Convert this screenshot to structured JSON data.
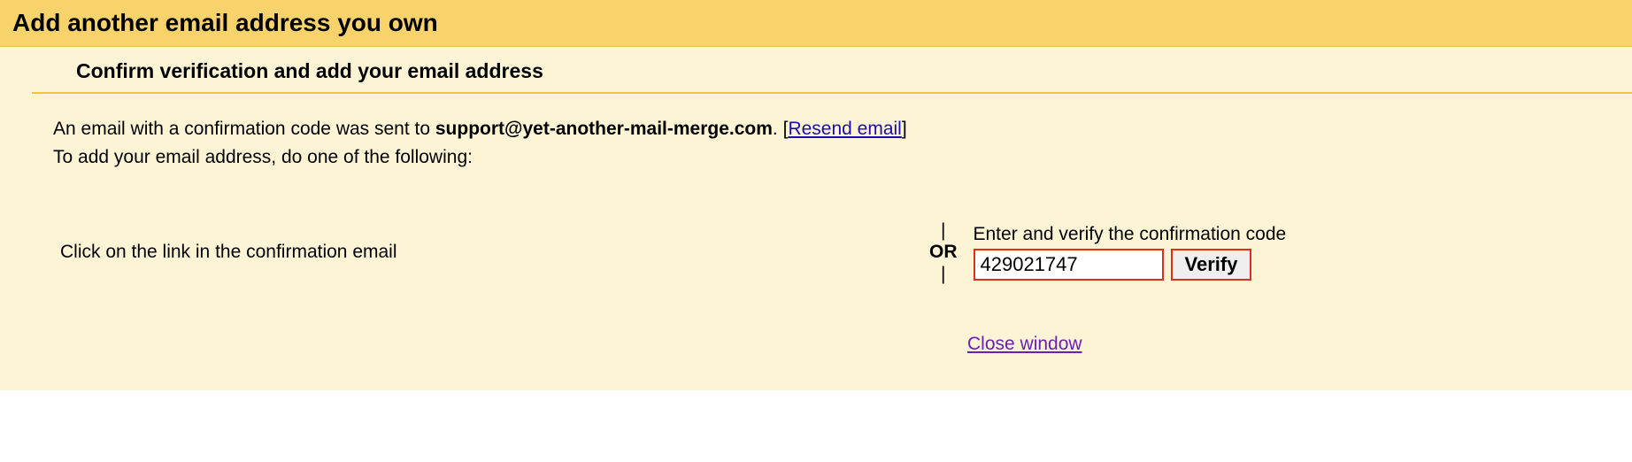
{
  "header": {
    "title": "Add another email address you own"
  },
  "subheader": {
    "title": "Confirm verification and add your email address"
  },
  "info": {
    "prefix": "An email with a confirmation code was sent to ",
    "email": "support@yet-another-mail-merge.com",
    "suffix_dot": ". ",
    "resend_open": "[",
    "resend_label": "Resend email",
    "resend_close": "]",
    "line2": "To add your email address, do one of the following:"
  },
  "options": {
    "left": "Click on the link in the confirmation email",
    "or": "OR",
    "pipe": "|",
    "right_label": "Enter and verify the confirmation code",
    "code_value": "429021747",
    "verify_button": "Verify"
  },
  "footer": {
    "close_label": "Close window"
  }
}
